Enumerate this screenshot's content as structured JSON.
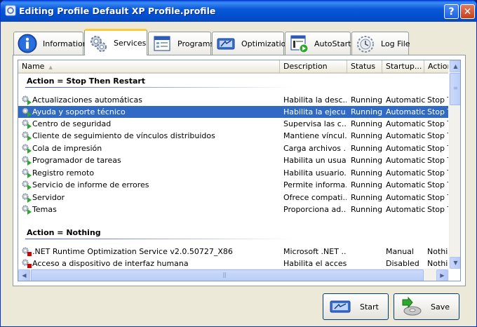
{
  "window": {
    "title": "Editing Profile Default XP Profile.profile",
    "help_label": "?",
    "close_label": "✕"
  },
  "tabs": [
    {
      "label": "Information",
      "icon": "info-icon"
    },
    {
      "label": "Services",
      "icon": "gears-icon",
      "active": true
    },
    {
      "label": "Programs",
      "icon": "program-window-icon"
    },
    {
      "label": "Optimization",
      "icon": "optimization-icon"
    },
    {
      "label": "AutoStart",
      "icon": "autostart-icon"
    },
    {
      "label": "Log File",
      "icon": "log-file-icon"
    }
  ],
  "columns": [
    "Name",
    "Description",
    "Status",
    "Startup...",
    "Action"
  ],
  "groups": [
    {
      "title": "Action = Stop Then Restart",
      "rows": [
        {
          "name": "Actualizaciones automáticas",
          "description": "Habilita la desc...",
          "status": "Running",
          "startup": "Automatic",
          "action": "Stop Th",
          "icon": "running-service-icon"
        },
        {
          "name": "Ayuda y soporte técnico",
          "description": "Habilita la ejecu...",
          "status": "Running",
          "startup": "Automatic",
          "action": "Stop Th",
          "icon": "running-service-icon",
          "selected": true
        },
        {
          "name": "Centro de seguridad",
          "description": "Supervisa las c...",
          "status": "Running",
          "startup": "Automatic",
          "action": "Stop Th",
          "icon": "running-service-icon"
        },
        {
          "name": "Cliente de seguimiento de vínculos distribuidos",
          "description": "Mantiene víncul...",
          "status": "Running",
          "startup": "Automatic",
          "action": "Stop Th",
          "icon": "running-service-icon"
        },
        {
          "name": "Cola de impresión",
          "description": "Carga archivos ...",
          "status": "Running",
          "startup": "Automatic",
          "action": "Stop Th",
          "icon": "running-service-icon"
        },
        {
          "name": "Programador de tareas",
          "description": "Habilita un usua...",
          "status": "Running",
          "startup": "Automatic",
          "action": "Stop Th",
          "icon": "running-service-icon"
        },
        {
          "name": "Registro remoto",
          "description": "Habilita usuario...",
          "status": "Running",
          "startup": "Automatic",
          "action": "Stop Th",
          "icon": "running-service-icon"
        },
        {
          "name": "Servicio de informe de errores",
          "description": "Permite informa...",
          "status": "Running",
          "startup": "Automatic",
          "action": "Stop Th",
          "icon": "running-service-icon"
        },
        {
          "name": "Servidor",
          "description": "Ofrece compati...",
          "status": "Running",
          "startup": "Automatic",
          "action": "Stop Th",
          "icon": "running-service-icon"
        },
        {
          "name": "Temas",
          "description": "Proporciona ad...",
          "status": "Running",
          "startup": "Automatic",
          "action": "Stop Th",
          "icon": "running-service-icon"
        }
      ]
    },
    {
      "title": "Action = Nothing",
      "rows": [
        {
          "name": ".NET Runtime Optimization Service v2.0.50727_X86",
          "description": "Microsoft .NET ...",
          "status": "",
          "startup": "Manual",
          "action": "Nothing",
          "icon": "stopped-service-icon"
        },
        {
          "name": "Acceso a dispositivo de interfaz humana",
          "description": "Habilita el acces...",
          "status": "",
          "startup": "Disabled",
          "action": "Nothing",
          "icon": "stopped-service-icon"
        }
      ]
    }
  ],
  "buttons": {
    "start": "Start",
    "save": "Save"
  },
  "colors": {
    "selection": "#316ac5",
    "titlebar": "#0a58d8",
    "running": "#2fa82f",
    "stopped": "#d40000"
  }
}
